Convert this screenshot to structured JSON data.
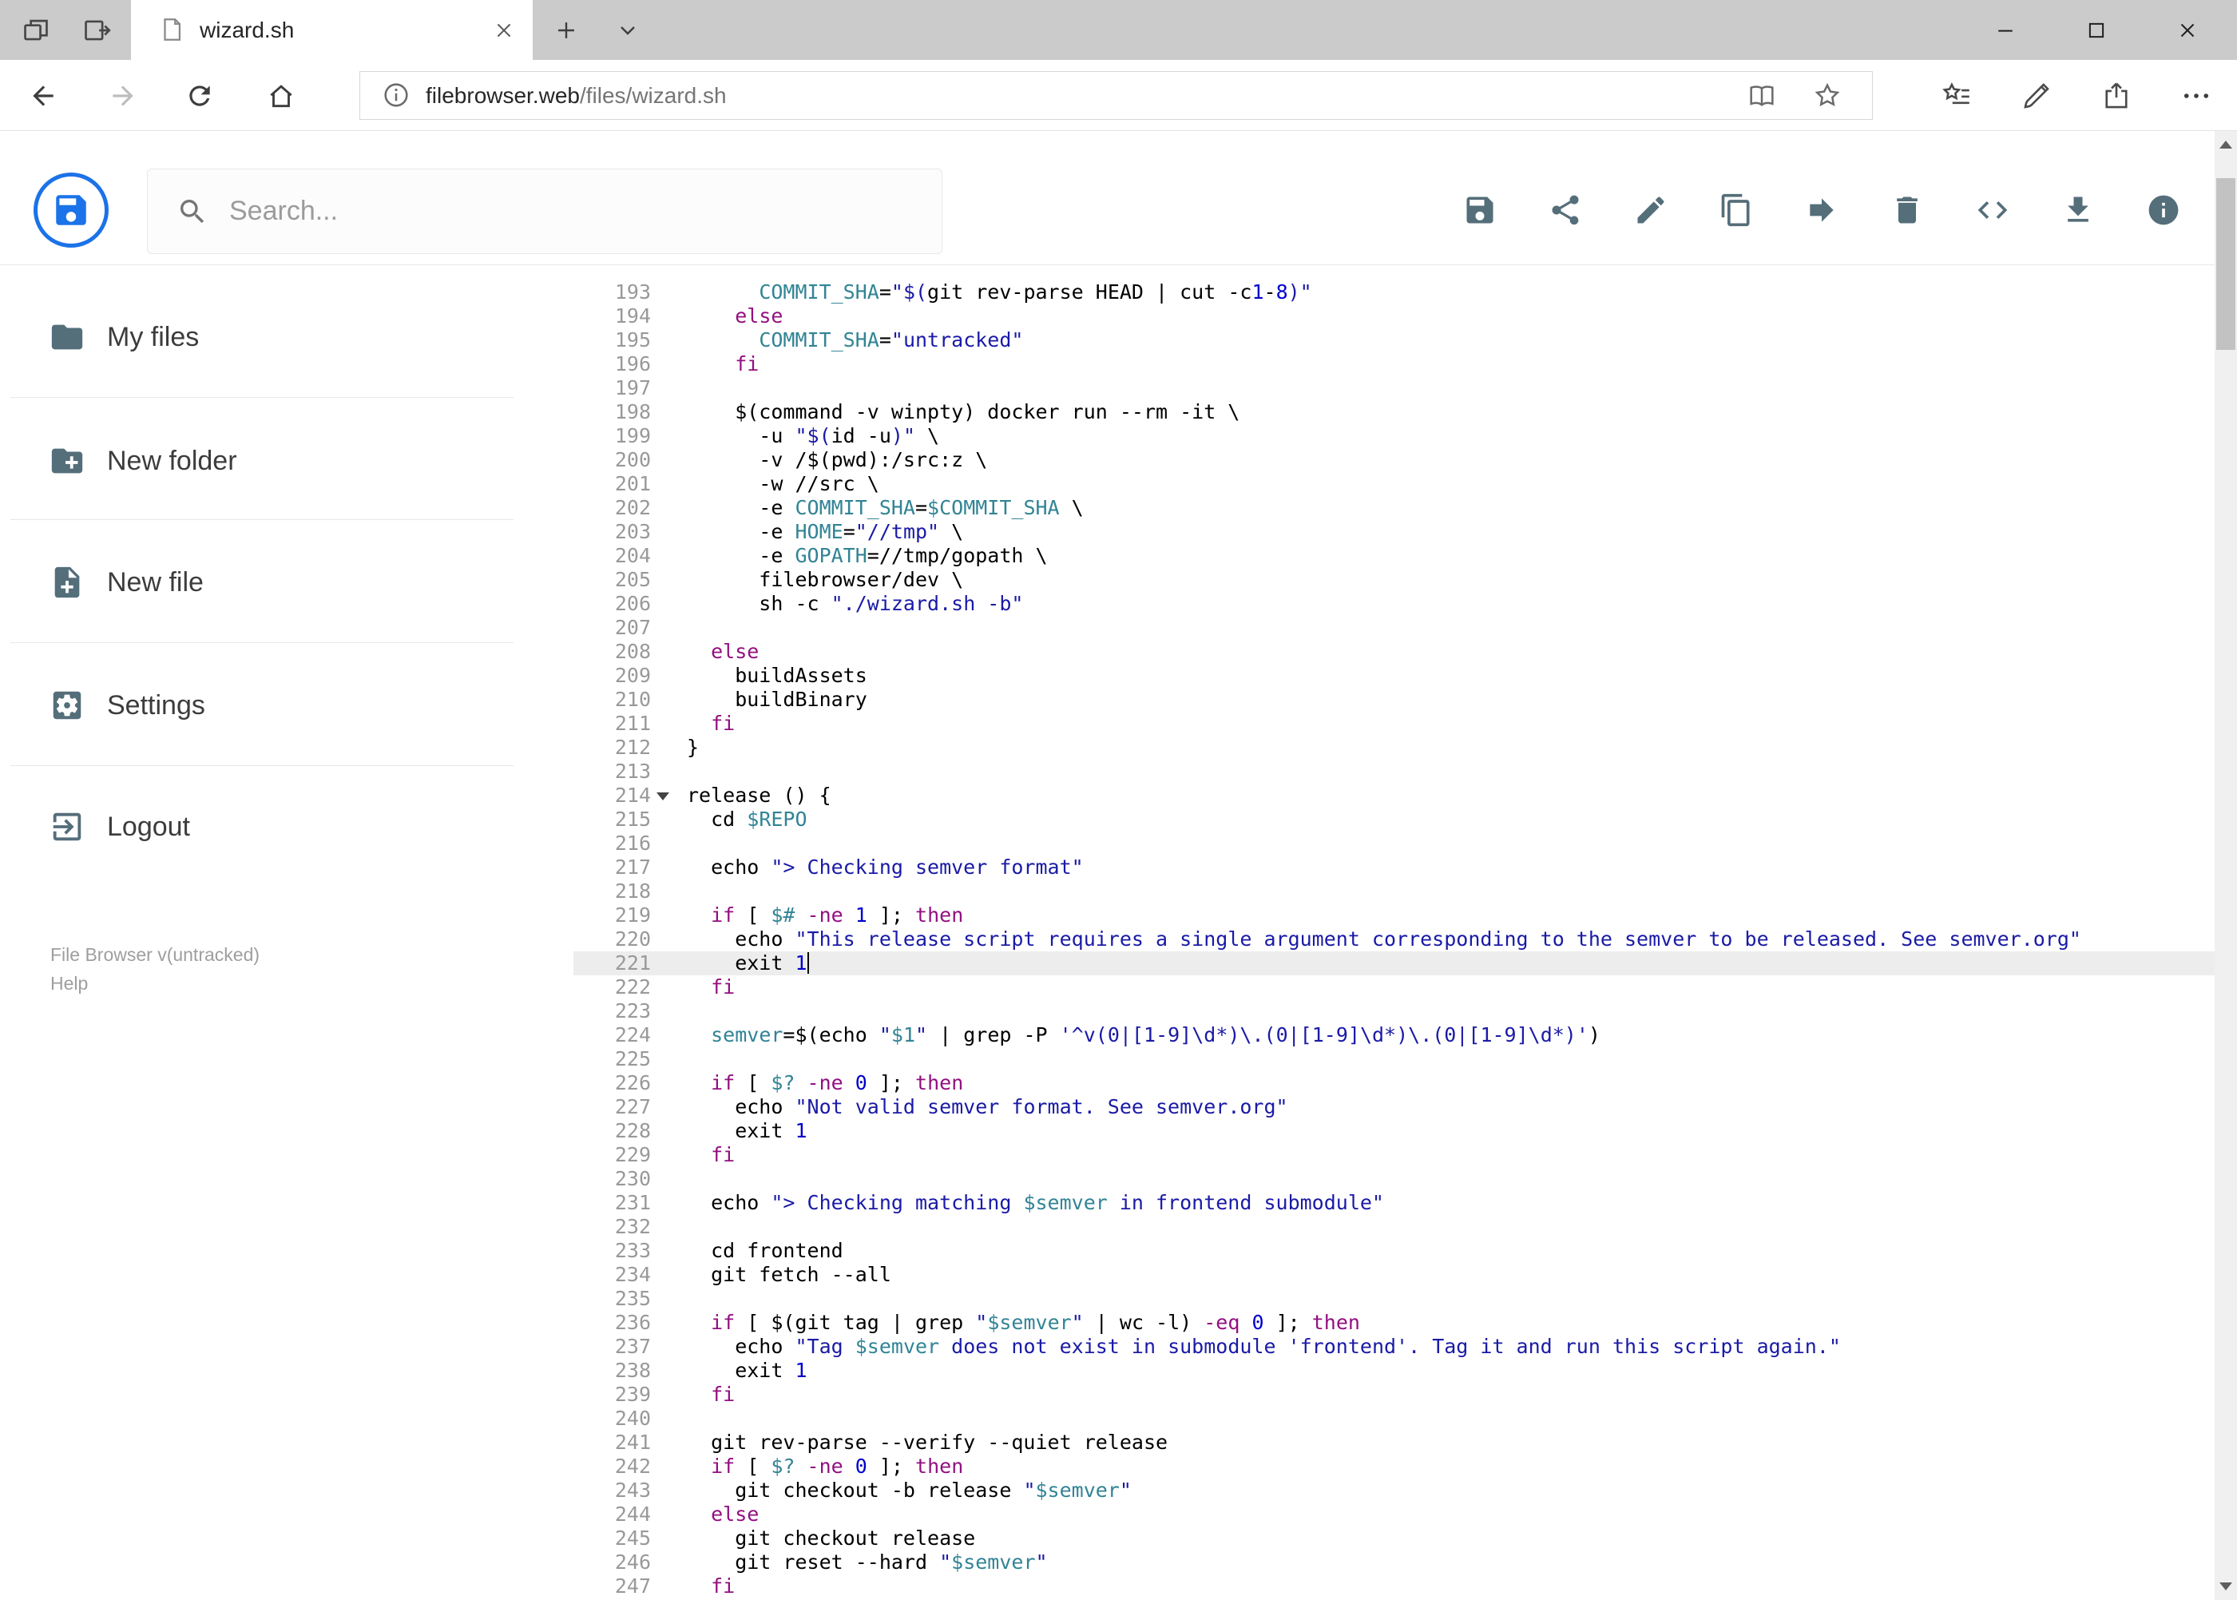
{
  "browser": {
    "tab_title": "wizard.sh",
    "url_domain": "filebrowser.web",
    "url_path": "/files/wizard.sh",
    "tab_action_icons": [
      "tab-preview",
      "set-tabs-aside"
    ],
    "nav_icons": [
      "back",
      "forward",
      "refresh",
      "home"
    ],
    "url_icons": [
      "site-info",
      "reading-view",
      "favorite-star"
    ],
    "action_icons": [
      "hub",
      "web-notes",
      "share",
      "more"
    ],
    "window_controls": [
      "minimize",
      "maximize",
      "close"
    ]
  },
  "app": {
    "search_placeholder": "Search...",
    "toolbar_icons": [
      "save",
      "share",
      "edit",
      "copy",
      "move",
      "delete",
      "code",
      "download",
      "info"
    ],
    "sidebar": {
      "items": [
        {
          "id": "my-files",
          "icon": "folder",
          "label": "My files"
        },
        {
          "id": "new-folder",
          "icon": "create-new-folder",
          "label": "New folder"
        },
        {
          "id": "new-file",
          "icon": "note-add",
          "label": "New file"
        },
        {
          "id": "settings",
          "icon": "settings",
          "label": "Settings"
        },
        {
          "id": "logout",
          "icon": "logout",
          "label": "Logout"
        }
      ],
      "version": "File Browser v(untracked)",
      "help": "Help"
    },
    "accent_color": "#1c72e8",
    "icon_color": "#546e7a"
  },
  "editor": {
    "first_line": 193,
    "active_line": 221,
    "fold_line": 214,
    "cursor": {
      "line": 221,
      "col": 10
    },
    "colors": {
      "text": "#000000",
      "keyword": "#930f80",
      "string": "#1a1aa6",
      "variable": "#318495",
      "number": "#0000cd"
    },
    "lines": [
      {
        "n": 193,
        "s": [
          [
            "t",
            "      "
          ],
          [
            "v",
            "COMMIT_SHA"
          ],
          [
            "t",
            "="
          ],
          [
            "s",
            "\"$("
          ],
          [
            "t",
            "git rev-parse HEAD | cut -c"
          ],
          [
            "n",
            "1"
          ],
          [
            "t",
            "-"
          ],
          [
            "n",
            "8"
          ],
          [
            "s",
            ")\""
          ]
        ]
      },
      {
        "n": 194,
        "s": [
          [
            "t",
            "    "
          ],
          [
            "k",
            "else"
          ]
        ]
      },
      {
        "n": 195,
        "s": [
          [
            "t",
            "      "
          ],
          [
            "v",
            "COMMIT_SHA"
          ],
          [
            "t",
            "="
          ],
          [
            "s",
            "\"untracked\""
          ]
        ]
      },
      {
        "n": 196,
        "s": [
          [
            "t",
            "    "
          ],
          [
            "k",
            "fi"
          ]
        ]
      },
      {
        "n": 197,
        "s": []
      },
      {
        "n": 198,
        "s": [
          [
            "t",
            "    $(command -v winpty) docker run --rm -it \\"
          ]
        ]
      },
      {
        "n": 199,
        "s": [
          [
            "t",
            "      -u "
          ],
          [
            "s",
            "\"$("
          ],
          [
            "t",
            "id -u"
          ],
          [
            "s",
            ")\""
          ],
          [
            "t",
            " \\"
          ]
        ]
      },
      {
        "n": 200,
        "s": [
          [
            "t",
            "      -v /$(pwd):/src:z \\"
          ]
        ]
      },
      {
        "n": 201,
        "s": [
          [
            "t",
            "      -w //src \\"
          ]
        ]
      },
      {
        "n": 202,
        "s": [
          [
            "t",
            "      -e "
          ],
          [
            "v",
            "COMMIT_SHA"
          ],
          [
            "t",
            "="
          ],
          [
            "v",
            "$COMMIT_SHA"
          ],
          [
            "t",
            " \\"
          ]
        ]
      },
      {
        "n": 203,
        "s": [
          [
            "t",
            "      -e "
          ],
          [
            "v",
            "HOME"
          ],
          [
            "t",
            "="
          ],
          [
            "s",
            "\"//tmp\""
          ],
          [
            "t",
            " \\"
          ]
        ]
      },
      {
        "n": 204,
        "s": [
          [
            "t",
            "      -e "
          ],
          [
            "v",
            "GOPATH"
          ],
          [
            "t",
            "=//tmp/gopath \\"
          ]
        ]
      },
      {
        "n": 205,
        "s": [
          [
            "t",
            "      filebrowser/dev \\"
          ]
        ]
      },
      {
        "n": 206,
        "s": [
          [
            "t",
            "      sh -c "
          ],
          [
            "s",
            "\"./wizard.sh -b\""
          ]
        ]
      },
      {
        "n": 207,
        "s": []
      },
      {
        "n": 208,
        "s": [
          [
            "t",
            "  "
          ],
          [
            "k",
            "else"
          ]
        ]
      },
      {
        "n": 209,
        "s": [
          [
            "t",
            "    buildAssets"
          ]
        ]
      },
      {
        "n": 210,
        "s": [
          [
            "t",
            "    buildBinary"
          ]
        ]
      },
      {
        "n": 211,
        "s": [
          [
            "t",
            "  "
          ],
          [
            "k",
            "fi"
          ]
        ]
      },
      {
        "n": 212,
        "s": [
          [
            "t",
            "}"
          ]
        ]
      },
      {
        "n": 213,
        "s": []
      },
      {
        "n": 214,
        "s": [
          [
            "t",
            "release () {"
          ]
        ]
      },
      {
        "n": 215,
        "s": [
          [
            "t",
            "  cd "
          ],
          [
            "v",
            "$REPO"
          ]
        ]
      },
      {
        "n": 216,
        "s": []
      },
      {
        "n": 217,
        "s": [
          [
            "t",
            "  echo "
          ],
          [
            "s",
            "\"> Checking semver format\""
          ]
        ]
      },
      {
        "n": 218,
        "s": []
      },
      {
        "n": 219,
        "s": [
          [
            "t",
            "  "
          ],
          [
            "k",
            "if"
          ],
          [
            "t",
            " [ "
          ],
          [
            "v",
            "$#"
          ],
          [
            "t",
            " "
          ],
          [
            "k",
            "-ne"
          ],
          [
            "t",
            " "
          ],
          [
            "n",
            "1"
          ],
          [
            "t",
            " ]; "
          ],
          [
            "k",
            "then"
          ]
        ]
      },
      {
        "n": 220,
        "s": [
          [
            "t",
            "    echo "
          ],
          [
            "s",
            "\"This release script requires a single argument corresponding to the semver to be released. See semver.org\""
          ]
        ]
      },
      {
        "n": 221,
        "s": [
          [
            "t",
            "    exit "
          ],
          [
            "n",
            "1"
          ]
        ]
      },
      {
        "n": 222,
        "s": [
          [
            "t",
            "  "
          ],
          [
            "k",
            "fi"
          ]
        ]
      },
      {
        "n": 223,
        "s": []
      },
      {
        "n": 224,
        "s": [
          [
            "t",
            "  "
          ],
          [
            "v",
            "semver"
          ],
          [
            "t",
            "=$(echo "
          ],
          [
            "s",
            "\""
          ],
          [
            "v",
            "$1"
          ],
          [
            "s",
            "\""
          ],
          [
            "t",
            " | grep -P "
          ],
          [
            "s",
            "'^v(0|[1-9]\\d*)\\.(0|[1-9]\\d*)\\.(0|[1-9]\\d*)'"
          ],
          [
            "t",
            ")"
          ]
        ]
      },
      {
        "n": 225,
        "s": []
      },
      {
        "n": 226,
        "s": [
          [
            "t",
            "  "
          ],
          [
            "k",
            "if"
          ],
          [
            "t",
            " [ "
          ],
          [
            "v",
            "$?"
          ],
          [
            "t",
            " "
          ],
          [
            "k",
            "-ne"
          ],
          [
            "t",
            " "
          ],
          [
            "n",
            "0"
          ],
          [
            "t",
            " ]; "
          ],
          [
            "k",
            "then"
          ]
        ]
      },
      {
        "n": 227,
        "s": [
          [
            "t",
            "    echo "
          ],
          [
            "s",
            "\"Not valid semver format. See semver.org\""
          ]
        ]
      },
      {
        "n": 228,
        "s": [
          [
            "t",
            "    exit "
          ],
          [
            "n",
            "1"
          ]
        ]
      },
      {
        "n": 229,
        "s": [
          [
            "t",
            "  "
          ],
          [
            "k",
            "fi"
          ]
        ]
      },
      {
        "n": 230,
        "s": []
      },
      {
        "n": 231,
        "s": [
          [
            "t",
            "  echo "
          ],
          [
            "s",
            "\"> Checking matching "
          ],
          [
            "v",
            "$semver"
          ],
          [
            "s",
            " in frontend submodule\""
          ]
        ]
      },
      {
        "n": 232,
        "s": []
      },
      {
        "n": 233,
        "s": [
          [
            "t",
            "  cd frontend"
          ]
        ]
      },
      {
        "n": 234,
        "s": [
          [
            "t",
            "  git fetch --all"
          ]
        ]
      },
      {
        "n": 235,
        "s": []
      },
      {
        "n": 236,
        "s": [
          [
            "t",
            "  "
          ],
          [
            "k",
            "if"
          ],
          [
            "t",
            " [ $(git tag | grep "
          ],
          [
            "s",
            "\""
          ],
          [
            "v",
            "$semver"
          ],
          [
            "s",
            "\""
          ],
          [
            "t",
            " | wc -l) "
          ],
          [
            "k",
            "-eq"
          ],
          [
            "t",
            " "
          ],
          [
            "n",
            "0"
          ],
          [
            "t",
            " ]; "
          ],
          [
            "k",
            "then"
          ]
        ]
      },
      {
        "n": 237,
        "s": [
          [
            "t",
            "    echo "
          ],
          [
            "s",
            "\"Tag "
          ],
          [
            "v",
            "$semver"
          ],
          [
            "s",
            " does not exist in submodule 'frontend'. Tag it and run this script again.\""
          ]
        ]
      },
      {
        "n": 238,
        "s": [
          [
            "t",
            "    exit "
          ],
          [
            "n",
            "1"
          ]
        ]
      },
      {
        "n": 239,
        "s": [
          [
            "t",
            "  "
          ],
          [
            "k",
            "fi"
          ]
        ]
      },
      {
        "n": 240,
        "s": []
      },
      {
        "n": 241,
        "s": [
          [
            "t",
            "  git rev-parse --verify --quiet release"
          ]
        ]
      },
      {
        "n": 242,
        "s": [
          [
            "t",
            "  "
          ],
          [
            "k",
            "if"
          ],
          [
            "t",
            " [ "
          ],
          [
            "v",
            "$?"
          ],
          [
            "t",
            " "
          ],
          [
            "k",
            "-ne"
          ],
          [
            "t",
            " "
          ],
          [
            "n",
            "0"
          ],
          [
            "t",
            " ]; "
          ],
          [
            "k",
            "then"
          ]
        ]
      },
      {
        "n": 243,
        "s": [
          [
            "t",
            "    git checkout -b release "
          ],
          [
            "s",
            "\""
          ],
          [
            "v",
            "$semver"
          ],
          [
            "s",
            "\""
          ]
        ]
      },
      {
        "n": 244,
        "s": [
          [
            "t",
            "  "
          ],
          [
            "k",
            "else"
          ]
        ]
      },
      {
        "n": 245,
        "s": [
          [
            "t",
            "    git checkout release"
          ]
        ]
      },
      {
        "n": 246,
        "s": [
          [
            "t",
            "    git reset --hard "
          ],
          [
            "s",
            "\""
          ],
          [
            "v",
            "$semver"
          ],
          [
            "s",
            "\""
          ]
        ]
      },
      {
        "n": 247,
        "s": [
          [
            "t",
            "  "
          ],
          [
            "k",
            "fi"
          ]
        ]
      }
    ]
  }
}
